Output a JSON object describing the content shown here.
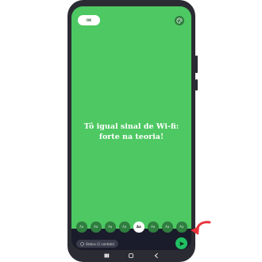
{
  "top_bar": {
    "done_label": "OK"
  },
  "status": {
    "lines": [
      "Tô igual sinal de Wi-fi:",
      "forte na teoria!"
    ]
  },
  "font_options": [
    {
      "label": "Aa",
      "selected": false
    },
    {
      "label": "Aa",
      "selected": false
    },
    {
      "label": "Aa",
      "selected": false
    },
    {
      "label": "Aa",
      "selected": false
    },
    {
      "label": "Aa",
      "selected": true
    },
    {
      "label": "Aa",
      "selected": false
    },
    {
      "label": "Aa",
      "selected": false
    },
    {
      "label": "Aa",
      "selected": false
    }
  ],
  "bottom_bar": {
    "audience_label": "Status (1 contato)"
  },
  "colors": {
    "canvas_background": "#4dc862",
    "send_button": "#21c063",
    "pointer_arrow": "#e8323a"
  },
  "icons": {
    "palette": "palette-icon",
    "send": "send-icon",
    "audience": "status-icon",
    "nav": [
      "recents-icon",
      "home-icon",
      "back-icon"
    ]
  }
}
